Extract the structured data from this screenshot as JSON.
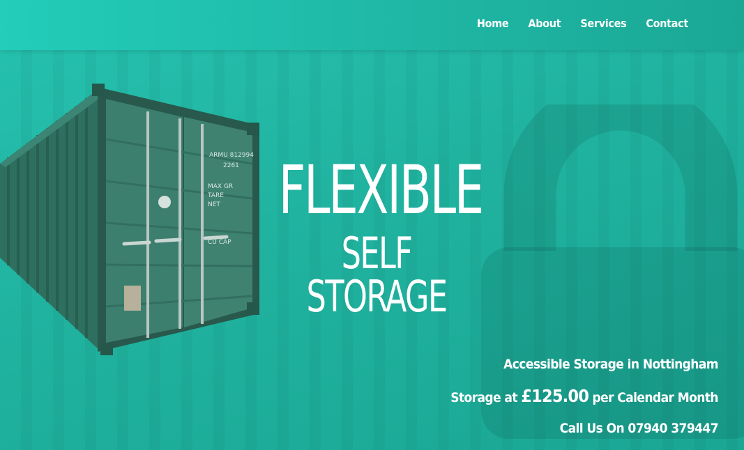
{
  "nav": {
    "items": [
      {
        "label": "Home"
      },
      {
        "label": "About"
      },
      {
        "label": "Services"
      },
      {
        "label": "Contact"
      }
    ]
  },
  "hero": {
    "title_line1": "FLEXIBLE",
    "title_line2": "SELF STORAGE"
  },
  "container": {
    "code": "ARMU 812994",
    "type": "2261",
    "markings": [
      "MAX GR",
      "TARE",
      "NET",
      "CU CAP"
    ]
  },
  "info": {
    "tagline": "Accessible Storage in Nottingham",
    "price_prefix": "Storage at ",
    "price": "£125.00",
    "price_suffix": " per Calendar Month",
    "phone": "Call Us On 07940 379447"
  },
  "colors": {
    "background": "#20b3a0",
    "header": "#22cdb9",
    "text": "#ffffff",
    "container": "#3b7a6a"
  },
  "icons": {
    "background_graphic": "padlock-icon"
  }
}
